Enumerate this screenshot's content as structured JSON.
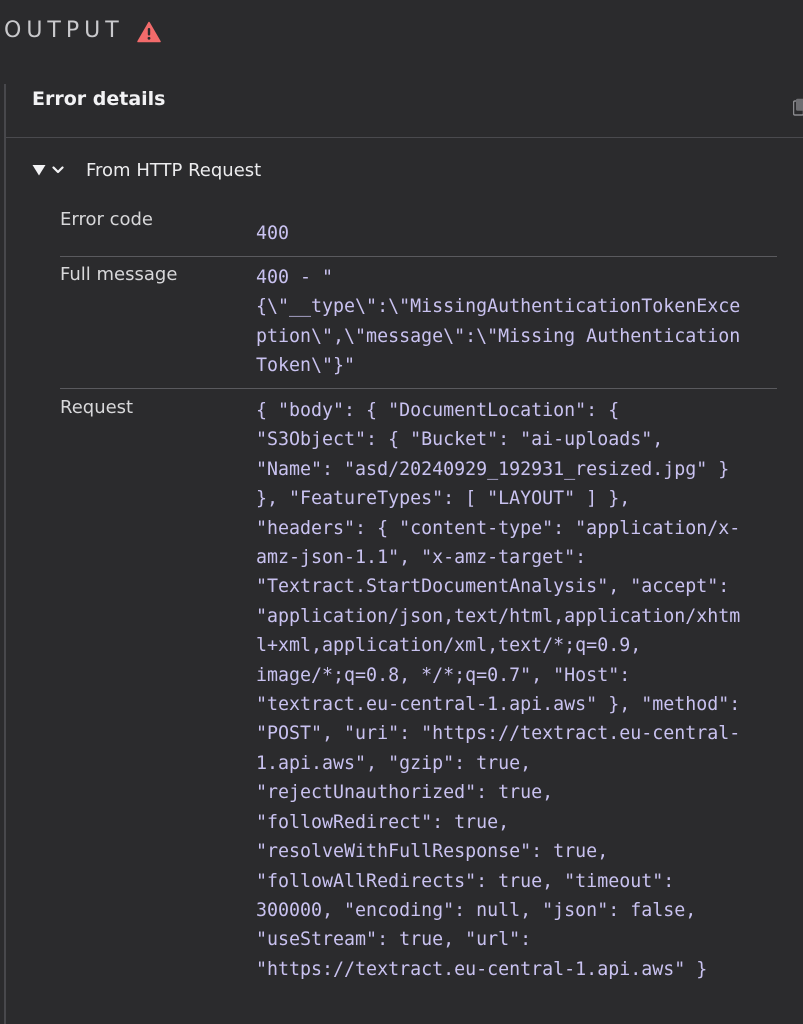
{
  "header": {
    "title": "OUTPUT",
    "status_icon": "warning-triangle-icon",
    "status_color": "#f26b6b"
  },
  "panel": {
    "title": "Error details",
    "copy_icon": "copy-icon"
  },
  "section": {
    "title": "From HTTP Request",
    "expanded": true
  },
  "fields": {
    "error_code": {
      "label": "Error code",
      "value": "400"
    },
    "full_message": {
      "label": "Full message",
      "value": "400 - \"\n{\\\"__type\\\":\\\"MissingAuthenticationTokenExce\nption\\\",\\\"message\\\":\\\"Missing Authentication\nToken\\\"}\""
    },
    "request": {
      "label": "Request",
      "value": "{ \"body\": { \"DocumentLocation\": {\n\"S3Object\": { \"Bucket\": \"ai-uploads\",\n\"Name\": \"asd/20240929_192931_resized.jpg\" }\n}, \"FeatureTypes\": [ \"LAYOUT\" ] },\n\"headers\": { \"content-type\": \"application/x-\namz-json-1.1\", \"x-amz-target\":\n\"Textract.StartDocumentAnalysis\", \"accept\":\n\"application/json,text/html,application/xhtm\nl+xml,application/xml,text/*;q=0.9,\nimage/*;q=0.8, */*;q=0.7\", \"Host\":\n\"textract.eu-central-1.api.aws\" }, \"method\":\n\"POST\", \"uri\": \"https://textract.eu-central-\n1.api.aws\", \"gzip\": true,\n\"rejectUnauthorized\": true,\n\"followRedirect\": true,\n\"resolveWithFullResponse\": true,\n\"followAllRedirects\": true, \"timeout\":\n300000, \"encoding\": null, \"json\": false,\n\"useStream\": true, \"url\":\n\"https://textract.eu-central-1.api.aws\" }"
    }
  }
}
